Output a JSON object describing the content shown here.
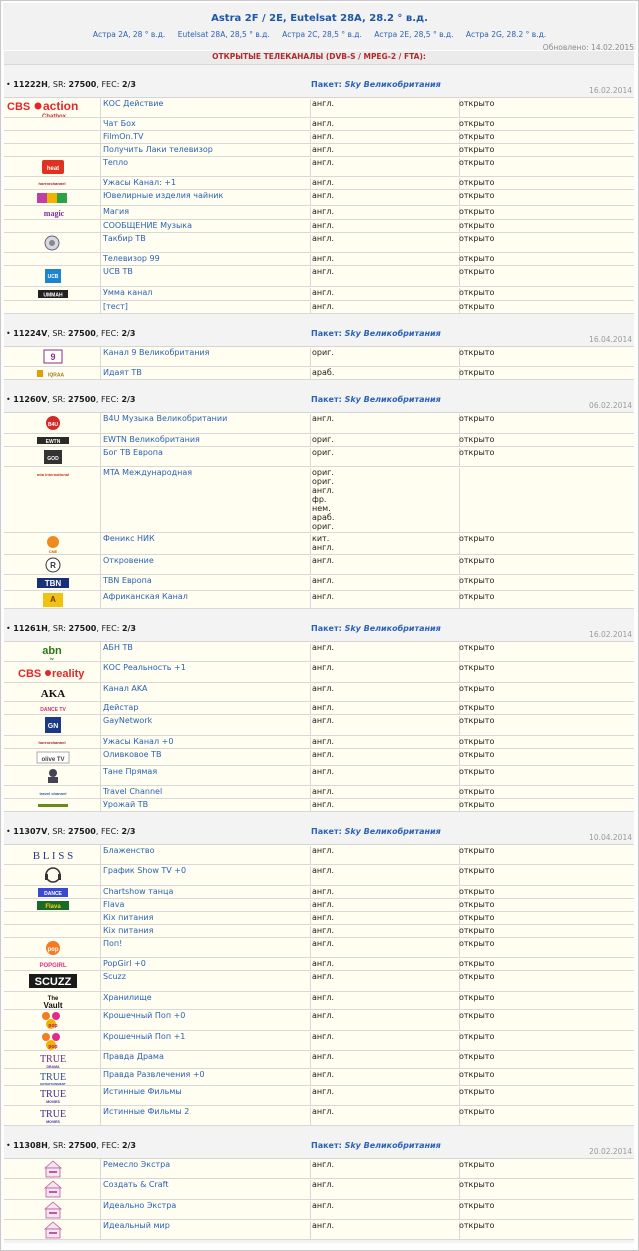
{
  "header": {
    "title": "Astra 2F / 2E, Eutelsat 28A, 28.2 ° в.д.",
    "links": [
      "Астра 2А, 28 ° в.д.",
      "Eutelsat 28A, 28,5 ° в.д.",
      "Астра 2C, 28,5 ° в.д.",
      "Астра 2E, 28,5 ° в.д.",
      "Астра 2G, 28.2 ° в.д."
    ],
    "updated": "Обновлено: 14.02.2015",
    "banner": "ОТКРЫТЫЕ ТЕЛЕКАНАЛЫ (DVB-S / MPEG-2 / FTA):"
  },
  "labels": {
    "sr": ", SR: ",
    "fec": ", FEC: ",
    "package": "Пакет: "
  },
  "transponders": [
    {
      "freq": "11222H",
      "sr": "27500",
      "fec": "2/3",
      "package": "Sky Великобритания",
      "date": "16.02.2014",
      "channels": [
        {
          "logo": "cbs-action-logo",
          "name": "КОС Действие",
          "lang": "англ.",
          "status": "открыто",
          "h": 20
        },
        {
          "logo": "",
          "name": "Чат Бох",
          "lang": "англ.",
          "status": "открыто",
          "h": 13
        },
        {
          "logo": "",
          "name": "FilmOn.TV",
          "lang": "англ.",
          "status": "открыто",
          "h": 13
        },
        {
          "logo": "",
          "name": "Получить Лаки телевизор",
          "lang": "англ.",
          "status": "открыто",
          "h": 13
        },
        {
          "logo": "heat-tv-logo",
          "name": "Тепло",
          "lang": "англ.",
          "status": "открыто",
          "h": 20
        },
        {
          "logo": "horror-channel-logo",
          "name": "Ужасы Канал: +1",
          "lang": "англ.",
          "status": "открыто",
          "h": 13
        },
        {
          "logo": "gems-tv-logo",
          "name": "Ювелирные изделия чайник",
          "lang": "англ.",
          "status": "открыто",
          "h": 16
        },
        {
          "logo": "magic-logo",
          "name": "Магия",
          "lang": "англ.",
          "status": "открыто",
          "h": 14
        },
        {
          "logo": "",
          "name": "СООБЩЕНИЕ Музыка",
          "lang": "англ.",
          "status": "открыто",
          "h": 13
        },
        {
          "logo": "takbeer-tv-logo",
          "name": "Такбир ТВ",
          "lang": "англ.",
          "status": "открыто",
          "h": 20
        },
        {
          "logo": "",
          "name": "Телевизор 99",
          "lang": "англ.",
          "status": "открыто",
          "h": 13
        },
        {
          "logo": "ucb-tv-logo",
          "name": "UCB ТВ",
          "lang": "англ.",
          "status": "открыто",
          "h": 21
        },
        {
          "logo": "ummah-logo",
          "name": "Умма канал",
          "lang": "англ.",
          "status": "открыто",
          "h": 14
        },
        {
          "logo": "",
          "name": "[тест]",
          "lang": "англ.",
          "status": "открыто",
          "h": 13
        }
      ]
    },
    {
      "freq": "11224V",
      "sr": "27500",
      "fec": "2/3",
      "package": "Sky Великобритания",
      "date": "16.04.2014",
      "channels": [
        {
          "logo": "channel-9-uk-logo",
          "name": "Канал 9 Великобритания",
          "lang": "ориг.",
          "status": "открыто",
          "h": 20
        },
        {
          "logo": "iqraa-logo",
          "name": "Идаят ТВ",
          "lang": "араб.",
          "status": "открыто",
          "h": 13
        }
      ]
    },
    {
      "freq": "11260V",
      "sr": "27500",
      "fec": "2/3",
      "package": "Sky Великобритания",
      "date": "06.02.2014",
      "channels": [
        {
          "logo": "b4u-music-logo",
          "name": "B4U Музыка Великобритании",
          "lang": "англ.",
          "status": "открыто",
          "h": 21
        },
        {
          "logo": "ewtn-logo",
          "name": "EWTN Великобритания",
          "lang": "ориг.",
          "status": "открыто",
          "h": 13
        },
        {
          "logo": "god-tv-logo",
          "name": "Бог ТВ Европа",
          "lang": "ориг.",
          "status": "открыто",
          "h": 20
        },
        {
          "logo": "mta-logo",
          "name": "MTA Международная",
          "lang": "ориг.\nориг.\nангл.\nфр.\nнем.\nараб.\nориг.",
          "status": "",
          "h": 66
        },
        {
          "logo": "phoenix-cne-logo",
          "name": "Феникс НИК",
          "lang": "кит.\nангл.",
          "status": "открыто",
          "h": 22
        },
        {
          "logo": "revelation-logo",
          "name": "Откровение",
          "lang": "англ.",
          "status": "открыто",
          "h": 20
        },
        {
          "logo": "tbn-logo",
          "name": "TBN Европа",
          "lang": "англ.",
          "status": "открыто",
          "h": 16
        },
        {
          "logo": "african-channel-logo",
          "name": "Африканская Канал",
          "lang": "англ.",
          "status": "открыто",
          "h": 18
        }
      ]
    },
    {
      "freq": "11261H",
      "sr": "27500",
      "fec": "2/3",
      "package": "Sky Великобритания",
      "date": "16.02.2014",
      "channels": [
        {
          "logo": "abn-tv-logo",
          "name": "АБН ТВ",
          "lang": "англ.",
          "status": "открыто",
          "h": 20
        },
        {
          "logo": "cbs-reality-logo",
          "name": "КОС Реальность +1",
          "lang": "англ.",
          "status": "открыто",
          "h": 21
        },
        {
          "logo": "aka-logo",
          "name": "Канал AKA",
          "lang": "англ.",
          "status": "открыто",
          "h": 19
        },
        {
          "logo": "dance-tv-logo",
          "name": "Дейстар",
          "lang": "англ.",
          "status": "открыто",
          "h": 13
        },
        {
          "logo": "gay-network-logo",
          "name": "GayNetwork",
          "lang": "англ.",
          "status": "открыто",
          "h": 21
        },
        {
          "logo": "horror-channel-logo",
          "name": "Ужасы Канал +0",
          "lang": "англ.",
          "status": "открыто",
          "h": 13
        },
        {
          "logo": "olive-tv-logo",
          "name": "Оливковое ТВ",
          "lang": "англ.",
          "status": "открыто",
          "h": 17
        },
        {
          "logo": "tbn-person-logo",
          "name": "Тане Прямая",
          "lang": "англ.",
          "status": "открыто",
          "h": 20
        },
        {
          "logo": "travel-channel-logo",
          "name": "Travel Channel",
          "lang": "англ.",
          "status": "открыто",
          "h": 13
        },
        {
          "logo": "harvest-tv-logo",
          "name": "Урожай ТВ",
          "lang": "англ.",
          "status": "открыто",
          "h": 13
        }
      ]
    },
    {
      "freq": "11307V",
      "sr": "27500",
      "fec": "2/3",
      "package": "Sky Великобритания",
      "date": "10.04.2014",
      "channels": [
        {
          "logo": "bliss-logo",
          "name": "Блаженство",
          "lang": "англ.",
          "status": "открыто",
          "h": 20
        },
        {
          "logo": "chartshow-tv-logo",
          "name": "График Show TV +0",
          "lang": "англ.",
          "status": "открыто",
          "h": 21
        },
        {
          "logo": "chartshow-dance-logo",
          "name": "Chartshow танца",
          "lang": "англ.",
          "status": "открыто",
          "h": 13
        },
        {
          "logo": "flava-logo",
          "name": "Flava",
          "lang": "англ.",
          "status": "открыто",
          "h": 13
        },
        {
          "logo": "",
          "name": "Кix питания",
          "lang": "англ.",
          "status": "открыто",
          "h": 13
        },
        {
          "logo": "",
          "name": "Кix питания",
          "lang": "англ.",
          "status": "открыто",
          "h": 13
        },
        {
          "logo": "pop-logo",
          "name": "Поп!",
          "lang": "англ.",
          "status": "открыто",
          "h": 20
        },
        {
          "logo": "popgirl-logo",
          "name": "PopGirl +0",
          "lang": "англ.",
          "status": "открыто",
          "h": 13
        },
        {
          "logo": "scuzz-logo",
          "name": "Scuzz",
          "lang": "англ.",
          "status": "открыто",
          "h": 21
        },
        {
          "logo": "the-vault-logo",
          "name": "Хранилище",
          "lang": "англ.",
          "status": "открыто",
          "h": 18
        },
        {
          "logo": "tiny-pop-logo",
          "name": "Крошечный Поп +0",
          "lang": "англ.",
          "status": "открыто",
          "h": 21
        },
        {
          "logo": "tiny-pop-logo",
          "name": "Крошечный Поп +1",
          "lang": "англ.",
          "status": "открыто",
          "h": 20
        },
        {
          "logo": "true-drama-logo",
          "name": "Правда Драма",
          "lang": "англ.",
          "status": "открыто",
          "h": 18
        },
        {
          "logo": "true-entertainment-logo",
          "name": "Правда Развлечения +0",
          "lang": "англ.",
          "status": "открыто",
          "h": 17
        },
        {
          "logo": "true-movies-logo",
          "name": "Истинные Фильмы",
          "lang": "англ.",
          "status": "открыто",
          "h": 20
        },
        {
          "logo": "true-movies-logo",
          "name": "Истинные Фильмы 2",
          "lang": "англ.",
          "status": "открыто",
          "h": 20
        }
      ]
    },
    {
      "freq": "11308H",
      "sr": "27500",
      "fec": "2/3",
      "package": "Sky Великобритания",
      "date": "20.02.2014",
      "channels": [
        {
          "logo": "craft-extra-logo",
          "name": "Ремесло Экстра",
          "lang": "англ.",
          "status": "открыто",
          "h": 20
        },
        {
          "logo": "create-craft-logo",
          "name": "Создать & Craft",
          "lang": "англ.",
          "status": "открыто",
          "h": 21
        },
        {
          "logo": "ideal-extra-logo",
          "name": "Идеально Экстра",
          "lang": "англ.",
          "status": "открыто",
          "h": 20
        },
        {
          "logo": "ideal-world-logo",
          "name": "Идеальный мир",
          "lang": "англ.",
          "status": "открыто",
          "h": 20
        }
      ]
    }
  ]
}
